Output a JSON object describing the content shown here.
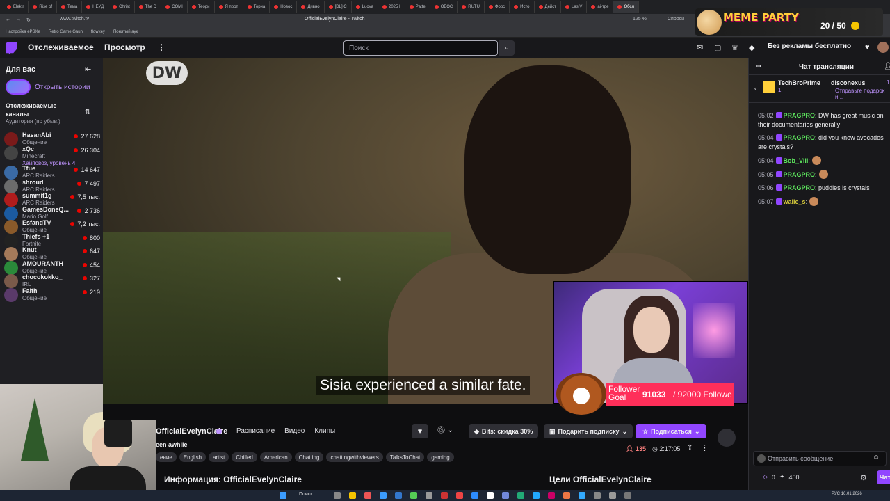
{
  "browser": {
    "tabs": [
      "Elektr",
      "Rise of",
      "Тема",
      "НЕУД",
      "Christ",
      "The D",
      "COMI",
      "Теори",
      "Я проп",
      "Торна",
      "Новос",
      "Дивно",
      "[DL] C",
      "Luova",
      "2025 I",
      "Patte",
      "ОБОС",
      "RUTU",
      "Форс",
      "Исто",
      "Дейст",
      "Las V",
      "ai-тре",
      "Обсл"
    ],
    "url": "www.twitch.tv",
    "page_title": "OfficialEvelynClaire - Twitch",
    "zoom": "125 %",
    "ask_label": "Спроси",
    "bookmarks": [
      "Настройка ePSXe",
      "Retro Game Gaun",
      "flowkey",
      "Понятый аук"
    ]
  },
  "meme_party": {
    "title": "MEME PARTY",
    "count": "20 / 50"
  },
  "topnav": {
    "following": "Отслеживаемое",
    "browse": "Просмотр",
    "more": "⋮",
    "search_placeholder": "Поиск",
    "no_ads": "Без рекламы бесплатно",
    "notif_count": "2"
  },
  "sidebar": {
    "for_you": "Для вас",
    "stories": "Открыть истории",
    "followed_header": "Отслеживаемые каналы",
    "sort_label": "Аудитория (по убыв.)",
    "channels": [
      {
        "name": "HasanAbi",
        "category": "Общение",
        "viewers": "27 628",
        "color": "#7a1a1a"
      },
      {
        "name": "xQc",
        "category": "Minecraft",
        "viewers": "26 304",
        "extra": "Хайповоз, уровень 4",
        "color": "#444"
      },
      {
        "name": "Tfue",
        "category": "ARC Raiders",
        "viewers": "14 647",
        "color": "#3a6aa5"
      },
      {
        "name": "shroud",
        "category": "ARC Raiders",
        "viewers": "7 497",
        "color": "#6b6b6b"
      },
      {
        "name": "summit1g",
        "category": "ARC Raiders",
        "viewers": "7,5 тыс.",
        "color": "#b01c1c"
      },
      {
        "name": "GamesDoneQ...",
        "category": "Mario Golf",
        "viewers": "2 736",
        "color": "#1b5aa0"
      },
      {
        "name": "EsfandTV",
        "category": "Общение",
        "viewers": "7,2 тыс.",
        "color": "#8a5a2a"
      },
      {
        "name": "Thiefs +1",
        "category": "Fortnite",
        "viewers": "800",
        "color": "#222"
      },
      {
        "name": "Knut",
        "category": "Общение",
        "viewers": "647",
        "color": "#a57a5a"
      },
      {
        "name": "AMOURANTH",
        "category": "Общение",
        "viewers": "454",
        "color": "#2a8a3a"
      },
      {
        "name": "chocokokko_",
        "category": "IRL",
        "viewers": "327",
        "color": "#7a5a4a"
      },
      {
        "name": "Faith",
        "category": "Общение",
        "viewers": "219",
        "color": "#5a3a6a"
      }
    ]
  },
  "video": {
    "logo": "DW",
    "subtitle": "Sisia experienced a similar fate."
  },
  "goal": {
    "label": "Follower Goal",
    "current": "91033",
    "total": "/ 92000 Followe"
  },
  "channel": {
    "name": "OfficialEvelynClaire",
    "title_fragment": "een awhile",
    "tabs": [
      "Расписание",
      "Видео",
      "Клипы"
    ],
    "bits": "Bits: скидка 30%",
    "gift": "Подарить подписку",
    "subscribe": "Подписаться",
    "viewers": "135",
    "uptime": "2:17:05",
    "tags": [
      "ение",
      "English",
      "artist",
      "Chilled",
      "American",
      "Chatting",
      "chattingwithviewers",
      "TalksToChat",
      "gaming"
    ],
    "about": "Информация: OfficialEvelynClaire",
    "goals": "Цели OfficialEvelynClaire"
  },
  "chat": {
    "header": "Чат трансляции",
    "gift_user1": "TechBroPrime",
    "gift_count1": "1",
    "gift_user2": "disconexus",
    "gift_count2": "1",
    "send_gift": "Отправьте подарок и...",
    "messages": [
      {
        "time": "05:02",
        "user": "PRAGPRO",
        "text": ": DW has great music on their documentaries generally",
        "emote": false
      },
      {
        "time": "05:04",
        "user": "PRAGPRO",
        "text": ": did you know avocados are crystals?",
        "emote": false
      },
      {
        "time": "05:04",
        "user": "Bob_Vill",
        "text": ":",
        "emote": true
      },
      {
        "time": "05:05",
        "user": "PRAGPRO",
        "text": ":",
        "emote": true
      },
      {
        "time": "05:06",
        "user": "PRAGPRO",
        "text": ": puddles is crystals",
        "emote": false
      },
      {
        "time": "05:07",
        "user": "walle_s",
        "text": ":",
        "emote": true
      }
    ],
    "input_placeholder": "Отправить сообщение",
    "points": "0",
    "bits": "450",
    "chat_button": "Чат"
  },
  "taskbar": {
    "search": "Поиск",
    "lang": "РУС",
    "date": "16.01.2026"
  }
}
